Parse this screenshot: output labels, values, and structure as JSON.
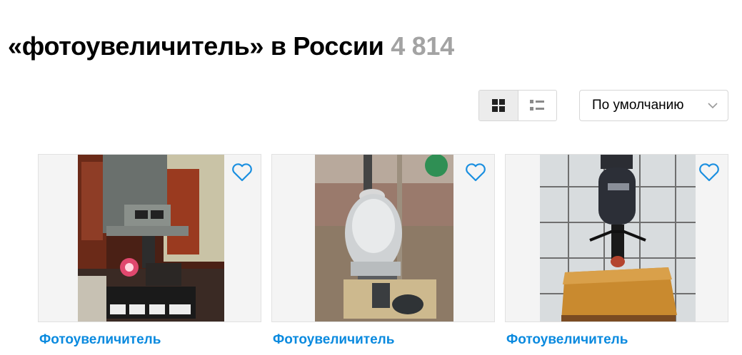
{
  "header": {
    "title": "«фотоувеличитель» в России",
    "count": "4 814"
  },
  "controls": {
    "view_modes": [
      {
        "icon": "grid-view-icon",
        "active": true
      },
      {
        "icon": "list-view-icon",
        "active": false
      }
    ],
    "sort": {
      "value": "По умолчанию",
      "icon": "chevron-down-icon"
    }
  },
  "listings": [
    {
      "title": "Фотоувеличитель",
      "favorite_icon": "heart-outline-icon"
    },
    {
      "title": "Фотоувеличитель",
      "favorite_icon": "heart-outline-icon"
    },
    {
      "title": "Фотоувеличитель",
      "favorite_icon": "heart-outline-icon"
    }
  ],
  "colors": {
    "link": "#0a8adf",
    "count": "#a3a3a3",
    "favorite": "#1a8fe0"
  }
}
